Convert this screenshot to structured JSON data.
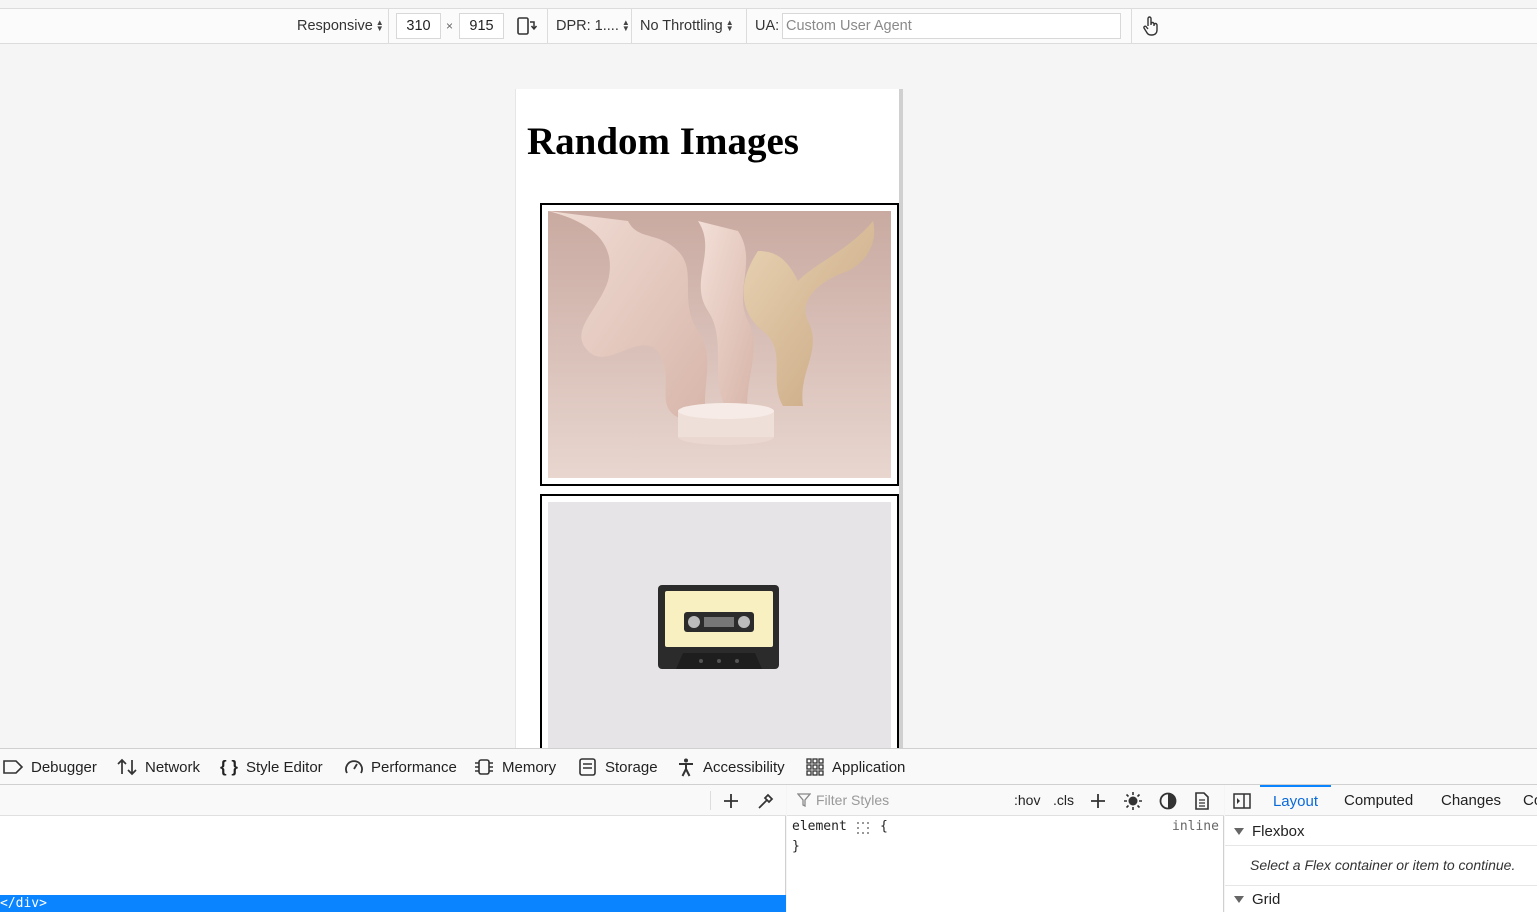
{
  "toolbar": {
    "device": "Responsive",
    "width": "310",
    "times": "×",
    "height": "915",
    "dpr": "DPR: 1....",
    "throttling": "No Throttling",
    "ua_label": "UA:",
    "ua_placeholder": "Custom User Agent"
  },
  "page": {
    "heading": "Random Images"
  },
  "devtools_tabs": [
    "Debugger",
    "Network",
    "Style Editor",
    "Performance",
    "Memory",
    "Storage",
    "Accessibility",
    "Application"
  ],
  "markup": {
    "selected_line": "</div>"
  },
  "rules": {
    "filter_placeholder": "Filter Styles",
    "hov": ":hov",
    "cls": ".cls",
    "selector": "element",
    "open_brace": "{",
    "close_brace": "}",
    "source": "inline"
  },
  "sidebar": {
    "tabs": [
      "Layout",
      "Computed",
      "Changes",
      "Co"
    ],
    "active_tab": "Layout",
    "flexbox_title": "Flexbox",
    "flexbox_message": "Select a Flex container or item to continue.",
    "grid_title": "Grid"
  },
  "colors": {
    "accent": "#0a84ff",
    "selected_row": "#0a84ff"
  }
}
